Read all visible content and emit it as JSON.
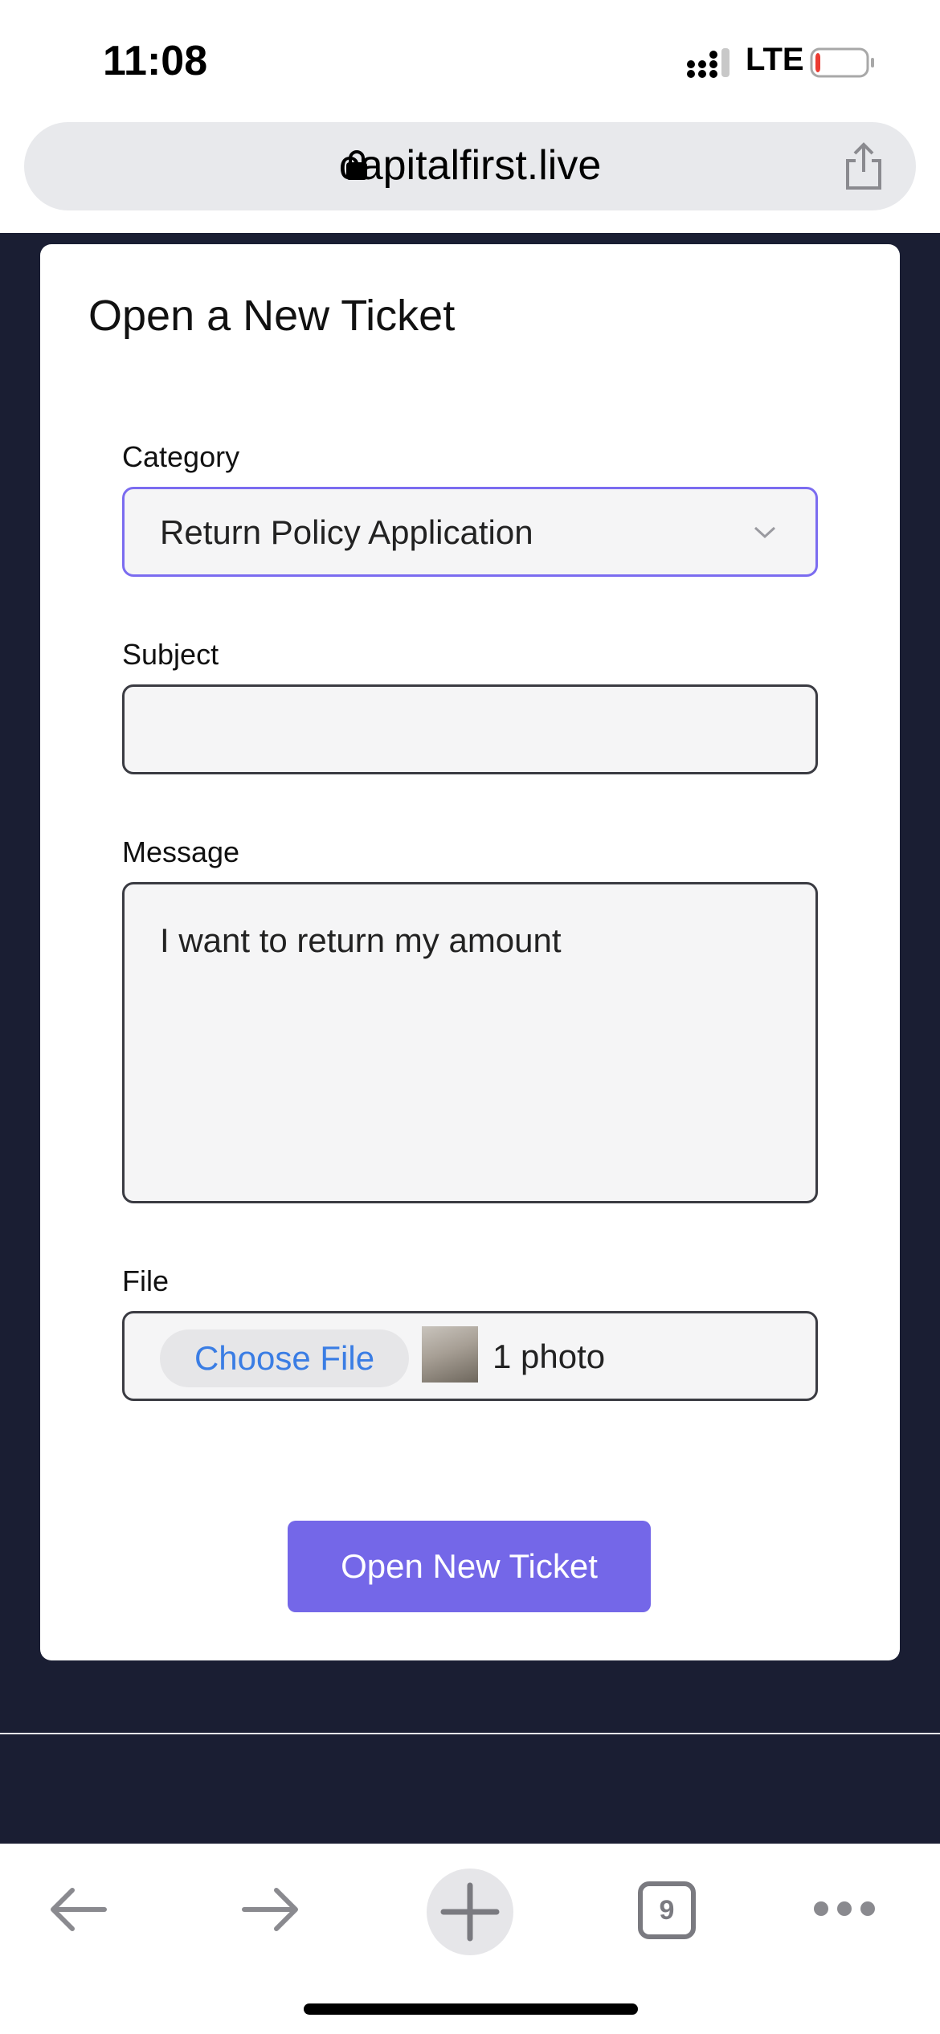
{
  "status_bar": {
    "time": "11:08",
    "network": "LTE",
    "battery_level": 0.1
  },
  "browser": {
    "url": "capitalfirst.live",
    "tab_count": "9"
  },
  "form": {
    "title": "Open a New Ticket",
    "category_label": "Category",
    "category_value": "Return Policy Application",
    "subject_label": "Subject",
    "subject_value": "",
    "message_label": "Message",
    "message_value": "I want to return my amount",
    "file_label": "File",
    "choose_file_label": "Choose File",
    "file_status": "1 photo",
    "submit_label": "Open New Ticket"
  },
  "colors": {
    "page_background": "#1a1e33",
    "accent": "#7467e8",
    "link_blue": "#3a7de4"
  }
}
